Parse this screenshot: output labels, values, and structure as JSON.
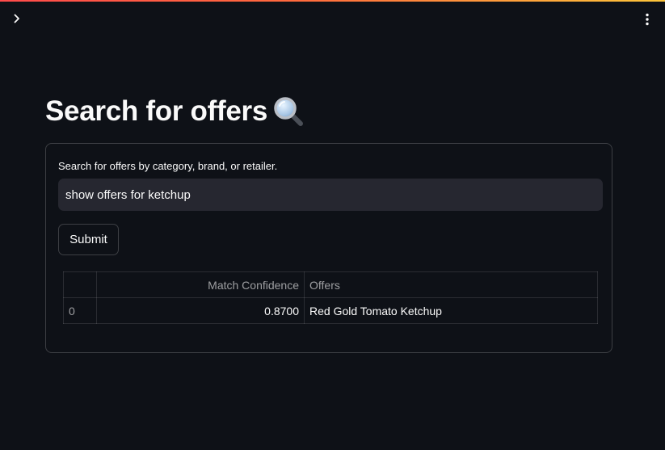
{
  "page": {
    "title": "Search for offers",
    "title_icon": "magnifier-icon"
  },
  "form": {
    "label": "Search for offers by category, brand, or retailer.",
    "input_value": "show offers for ketchup",
    "submit_label": "Submit"
  },
  "table": {
    "columns": [
      "",
      "Match Confidence",
      "Offers"
    ],
    "rows": [
      {
        "index": "0",
        "confidence": "0.8700",
        "offer": "Red Gold Tomato Ketchup"
      }
    ]
  },
  "icons": {
    "sidebar_toggle": "chevron-right-icon",
    "menu": "kebab-menu-icon"
  },
  "colors": {
    "background": "#0e1117",
    "input_bg": "#262730",
    "text": "#fafafa",
    "accent_gradient_start": "#ff4b4b",
    "accent_gradient_end": "#fdc53a"
  }
}
